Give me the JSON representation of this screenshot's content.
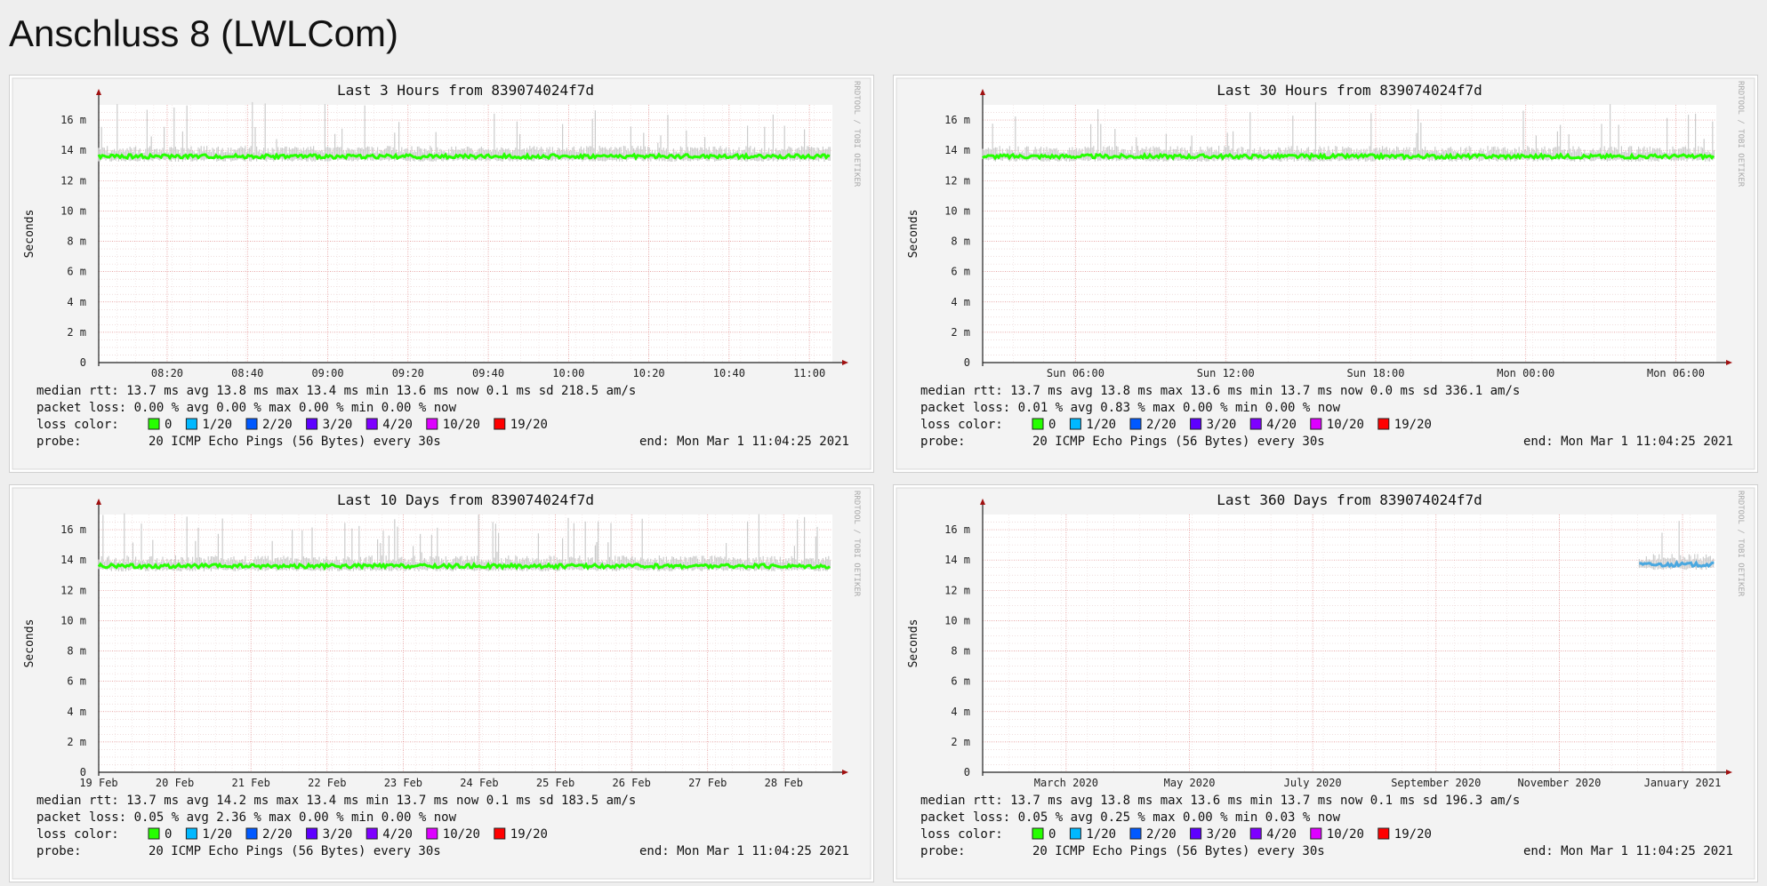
{
  "page": {
    "title": "Anschluss 8 (LWLCom)"
  },
  "common": {
    "y_label": "Seconds",
    "watermark": "RRDTOOL / TOBI OETIKER",
    "y_ticks": [
      "0",
      "2 m",
      "4 m",
      "6 m",
      "8 m",
      "10 m",
      "12 m",
      "14 m",
      "16 m"
    ],
    "legend": {
      "loss_label": "loss color:",
      "probe_label": "probe:",
      "probe_text": "20 ICMP Echo Pings (56 Bytes) every 30s",
      "end_text": "end: Mon Mar  1 11:04:25 2021",
      "loss_items": [
        {
          "label": "0",
          "color": "#26ff00"
        },
        {
          "label": "1/20",
          "color": "#00b8ff"
        },
        {
          "label": "2/20",
          "color": "#0059ff"
        },
        {
          "label": "3/20",
          "color": "#5e00ff"
        },
        {
          "label": "4/20",
          "color": "#7e00ff"
        },
        {
          "label": "10/20",
          "color": "#dd00ff"
        },
        {
          "label": "19/20",
          "color": "#ff0000"
        }
      ]
    }
  },
  "chart_data": [
    {
      "type": "line",
      "title": "Last 3 Hours from 839074024f7d",
      "ylabel": "Seconds",
      "ylim": [
        0,
        17
      ],
      "x_ticks": [
        "08:20",
        "08:40",
        "09:00",
        "09:20",
        "09:40",
        "10:00",
        "10:20",
        "10:40",
        "11:00"
      ],
      "median_ms": 13.6,
      "loss_color": "#26ff00",
      "stats": {
        "rtt": "median rtt:   13.7 ms avg   13.8 ms max   13.4 ms min   13.6 ms now   0.1 ms sd   218.5    am/s",
        "loss": "packet loss:  0.00 % avg   0.00 % max   0.00 % min   0.00 % now"
      }
    },
    {
      "type": "line",
      "title": "Last 30 Hours from 839074024f7d",
      "ylabel": "Seconds",
      "ylim": [
        0,
        17
      ],
      "x_ticks": [
        "Sun 06:00",
        "Sun 12:00",
        "Sun 18:00",
        "Mon 00:00",
        "Mon 06:00"
      ],
      "median_ms": 13.6,
      "loss_color": "#26ff00",
      "stats": {
        "rtt": "median rtt:   13.7 ms avg   13.8 ms max   13.6 ms min   13.7 ms now   0.0 ms sd   336.1    am/s",
        "loss": "packet loss:  0.01 % avg   0.83 % max   0.00 % min   0.00 % now"
      }
    },
    {
      "type": "line",
      "title": "Last 10 Days from 839074024f7d",
      "ylabel": "Seconds",
      "ylim": [
        0,
        17
      ],
      "x_ticks": [
        "19 Feb",
        "20 Feb",
        "21 Feb",
        "22 Feb",
        "23 Feb",
        "24 Feb",
        "25 Feb",
        "26 Feb",
        "27 Feb",
        "28 Feb"
      ],
      "median_ms": 13.6,
      "loss_color": "#26ff00",
      "stats": {
        "rtt": "median rtt:   13.7 ms avg   14.2 ms max   13.4 ms min   13.7 ms now   0.1 ms sd   183.5    am/s",
        "loss": "packet loss:  0.05 % avg   2.36 % max   0.00 % min   0.00 % now"
      }
    },
    {
      "type": "line",
      "title": "Last 360 Days from 839074024f7d",
      "ylabel": "Seconds",
      "ylim": [
        0,
        17
      ],
      "x_ticks": [
        "March 2020",
        "May 2020",
        "July 2020",
        "September 2020",
        "November 2020",
        "January 2021"
      ],
      "median_ms": 13.7,
      "data_start_fraction": 0.895,
      "loss_color": "#4aa8e0",
      "stats": {
        "rtt": "median rtt:   13.7 ms avg   13.8 ms max   13.6 ms min   13.7 ms now   0.1 ms sd   196.3    am/s",
        "loss": "packet loss:  0.05 % avg   0.25 % max   0.00 % min   0.03 % now"
      }
    }
  ]
}
